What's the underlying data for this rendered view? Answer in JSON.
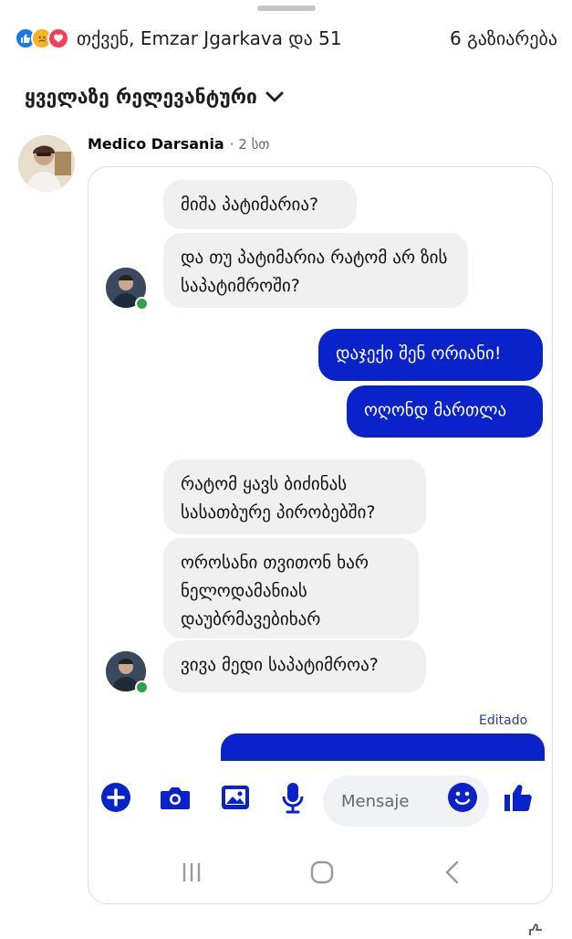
{
  "reactions": {
    "icons": [
      "like-icon",
      "sad-icon",
      "love-icon"
    ],
    "summary": "თქვენ, Emzar Jgarkava და 51",
    "shares": "6 გაზიარება"
  },
  "sort": {
    "label": "ყველაზე რელევანტური"
  },
  "comment": {
    "author": "Medico Darsania",
    "time": "· 2 სთ"
  },
  "chat": {
    "messages": [
      {
        "text": "მიშა პატიმარია?",
        "side": "in"
      },
      {
        "text": "და თუ პატიმარია რატომ არ ზის საპატიმროში?",
        "side": "in"
      },
      {
        "text": "დაჯექი შენ ორიანი!",
        "side": "out"
      },
      {
        "text": "ოღონდ მართლა",
        "side": "out"
      },
      {
        "text": "რატომ ყავს ბიძინას სასათბურე პირობებში?",
        "side": "in"
      },
      {
        "text": "ოროსანი თვითონ ხარ ნელოდამანიას დაუბრმავებიხარ",
        "side": "in"
      },
      {
        "text": "ვივა მედი საპატიმროა?",
        "side": "in"
      }
    ],
    "edited_label": "Editado"
  },
  "composer": {
    "placeholder": "Mensaje",
    "icons": [
      "plus-icon",
      "camera-icon",
      "gallery-icon",
      "microphone-icon",
      "emoji-icon",
      "thumbs-up-icon"
    ],
    "accent": "#0a22c9"
  },
  "android_nav": {
    "icons": [
      "recents-icon",
      "home-icon",
      "back-icon"
    ]
  },
  "colors": {
    "outgoing_bubble": "#0a22c9",
    "incoming_bubble": "#f0f0f0",
    "like": "#1877f2",
    "love": "#f33e58"
  }
}
